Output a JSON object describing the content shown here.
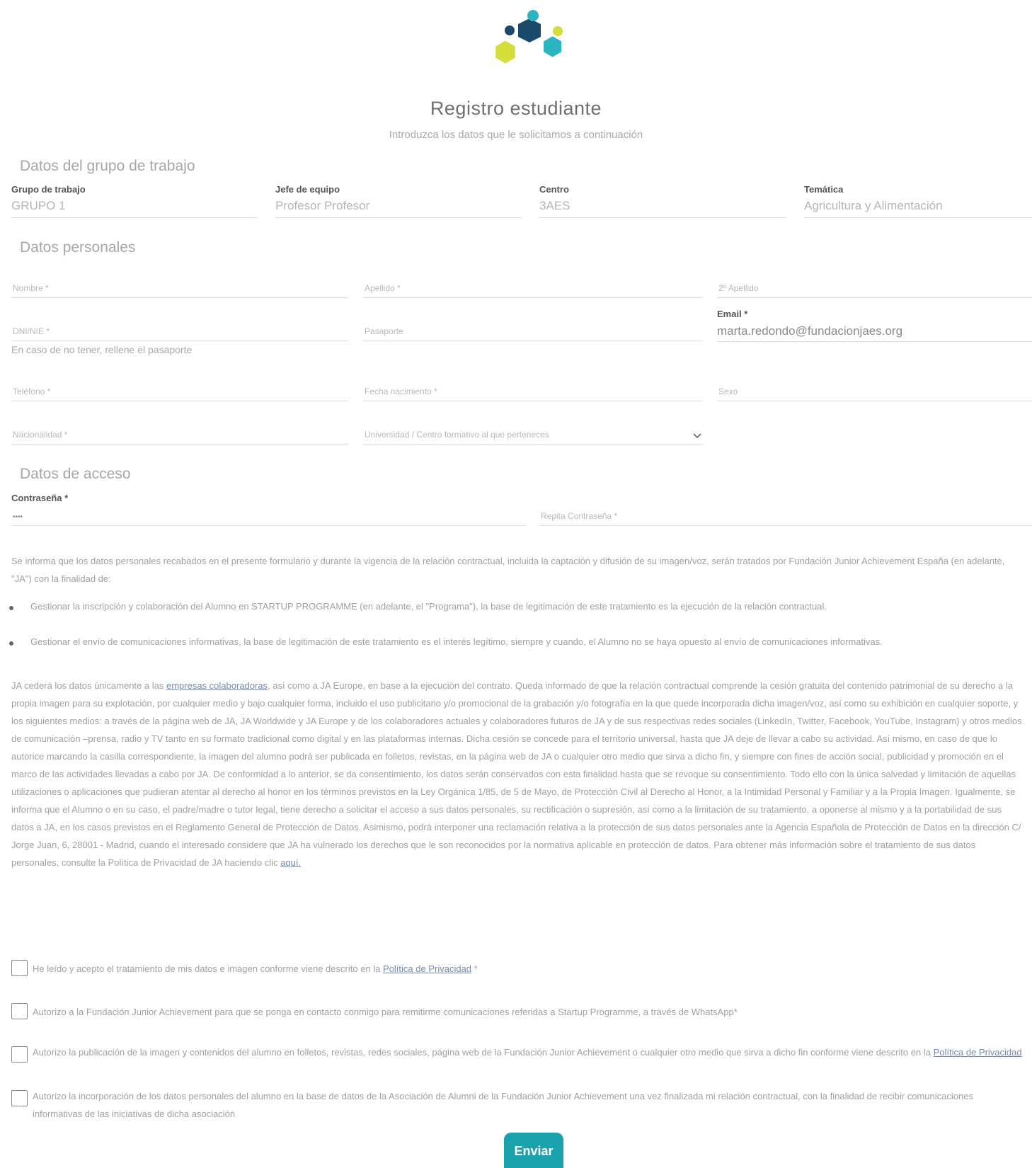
{
  "header": {
    "title": "Registro estudiante",
    "subtitle": "Introduzca los datos que le solicitamos a continuación"
  },
  "logo": {
    "icon": "hexagon-cluster-logo",
    "colors": [
      "#1a4a6b",
      "#2cb5c0",
      "#d5dd3a"
    ]
  },
  "group_section": {
    "title": "Datos del grupo de trabajo",
    "fields": [
      {
        "label": "Grupo de trabajo",
        "value": "GRUPO 1"
      },
      {
        "label": "Jefe de equipo",
        "value": "Profesor Profesor"
      },
      {
        "label": "Centro",
        "value": "3AES"
      },
      {
        "label": "Temática",
        "value": "Agricultura y Alimentación"
      }
    ]
  },
  "personal_section": {
    "title": "Datos personales",
    "nombre_placeholder": "Nombre *",
    "apellido_placeholder": "Apellido *",
    "apellido2_placeholder": "2º Apellido",
    "dni_placeholder": "DNI/NIE *",
    "pasaporte_placeholder": "Pasaporte",
    "dni_hint": "En caso de no tener, rellene el pasaporte",
    "email_label": "Email *",
    "email_value": "marta.redondo@fundacionjaes.org",
    "telefono_placeholder": "Teléfono *",
    "nacimiento_placeholder": "Fecha nacimiento *",
    "sexo_placeholder": "Sexo",
    "nacionalidad_placeholder": "Nacionalidad *",
    "universidad_placeholder": "Universidad / Centro formativo al que perteneces"
  },
  "access_section": {
    "title": "Datos de acceso",
    "password_label": "Contraseña *",
    "password_value": "••••",
    "repeat_placeholder": "Repita Contraseña *"
  },
  "legal": {
    "intro": "Se informa que los datos personales recabados en el presente formulario y durante la vigencia de la relación contractual, incluida la captación y difusión de su imagen/voz, serán tratados por Fundación Junior Achievement España (en adelante, \"JA\") con la finalidad de:",
    "bullets": [
      "Gestionar la inscripción y colaboración del Alumno en STARTUP PROGRAMME (en adelante, el \"Programa\"), la base de legitimación de este tratamiento es la ejecución de la relación contractual.",
      "Gestionar el envío de comunicaciones informativas, la base de legitimación de este tratamiento es el interés legítimo, siempre y cuando, el Alumno no se haya opuesto al envío de comunicaciones informativas."
    ],
    "body_before_link": "JA cederá los datos únicamente a las",
    "body_link": "empresas colaboradoras",
    "body_after_link": ", así como a JA Europe, en base a la ejecución del contrato. Queda informado de que la relación contractual comprende la cesión gratuita del contenido patrimonial de su derecho a la propia imagen para su explotación, por cualquier medio y bajo cualquier forma, incluido el uso publicitario y/o promocional de la grabación y/o fotografía en la que quede incorporada dicha imagen/voz, así como su exhibición en cualquier soporte, y los siguientes medios: a través de la página web de JA, JA Worldwide y JA Europe y de los colaboradores actuales y colaboradores futuros de JA y de sus respectivas redes sociales (LinkedIn, Twitter, Facebook, YouTube, Instagram) y otros medios de comunicación –prensa, radio y TV tanto en su formato tradicional como digital y en las plataformas internas. Dicha cesión se concede para el territorio universal, hasta que JA deje de llevar a cabo su actividad. Así mismo, en caso de que lo autorice marcando la casilla correspondiente, la imagen del alumno podrá ser publicada en folletos, revistas, en la página web de JA o cualquier otro medio que sirva a dicho fin, y siempre con fines de acción social, publicidad y promoción en el marco de las actividades llevadas a cabo por JA. De conformidad a lo anterior, se da consentimiento, los datos serán conservados con esta finalidad hasta que se revoque su consentimiento. Todo ello con la única salvedad y limitación de aquellas utilizaciones o aplicaciones que pudieran atentar al derecho al honor en los términos previstos en la Ley Orgánica 1/85, de 5 de Mayo, de Protección Civil al Derecho al Honor, a la Intimidad Personal y Familiar y a la Propia Imagen. Igualmente, se informa que el Alumno o en su caso, el padre/madre o tutor legal, tiene derecho a solicitar el acceso a sus datos personales, su rectificación o supresión, así como a la limitación de su tratamiento, a oponerse al mismo y a la portabilidad de sus datos a JA, en los casos previstos en el Reglamento General de Protección de Datos. Asimismo, podrá interponer una reclamación relativa a la protección de sus datos personales ante la Agencia Española de Protección de Datos en la dirección C/ Jorge Juan, 6, 28001 - Madrid, cuando el interesado considere que JA ha vulnerado los derechos que le son reconocidos por la normativa aplicable en protección de datos. Para obtener más información sobre el tratamiento de sus datos personales, consulte la Política de Privacidad de JA haciendo clic",
    "body_end_link": "aquí."
  },
  "consents": [
    {
      "before": "He leído y acepto el tratamiento de mis datos e imagen conforme viene descrito en la",
      "link": "Política de Privacidad",
      "after": " *"
    },
    {
      "before": "Autorizo a la Fundación Junior Achievement para que se ponga en contacto conmigo para remitirme comunicaciones referidas a Startup Programme, a través de WhatsApp*",
      "link": "",
      "after": ""
    },
    {
      "before": "Autorizo la publicación de la imagen y contenidos del alumno en folletos, revistas, redes sociales, página web de la Fundación Junior Achievement o cualquier otro medio que sirva a dicho fin conforme viene descrito en la",
      "link": "Política de Privacidad",
      "after": ""
    },
    {
      "before": "Autorizo la incorporación de los datos personales del alumno en la base de datos de la Asociación de Alumni de la Fundación Junior Achievement una vez finalizada mi relación contractual, con la finalidad de recibir comunicaciones informativas de las iniciativas de dicha asociación",
      "link": "",
      "after": ""
    }
  ],
  "submit_label": "Enviar",
  "colors": {
    "accent": "#1ba3ad"
  }
}
